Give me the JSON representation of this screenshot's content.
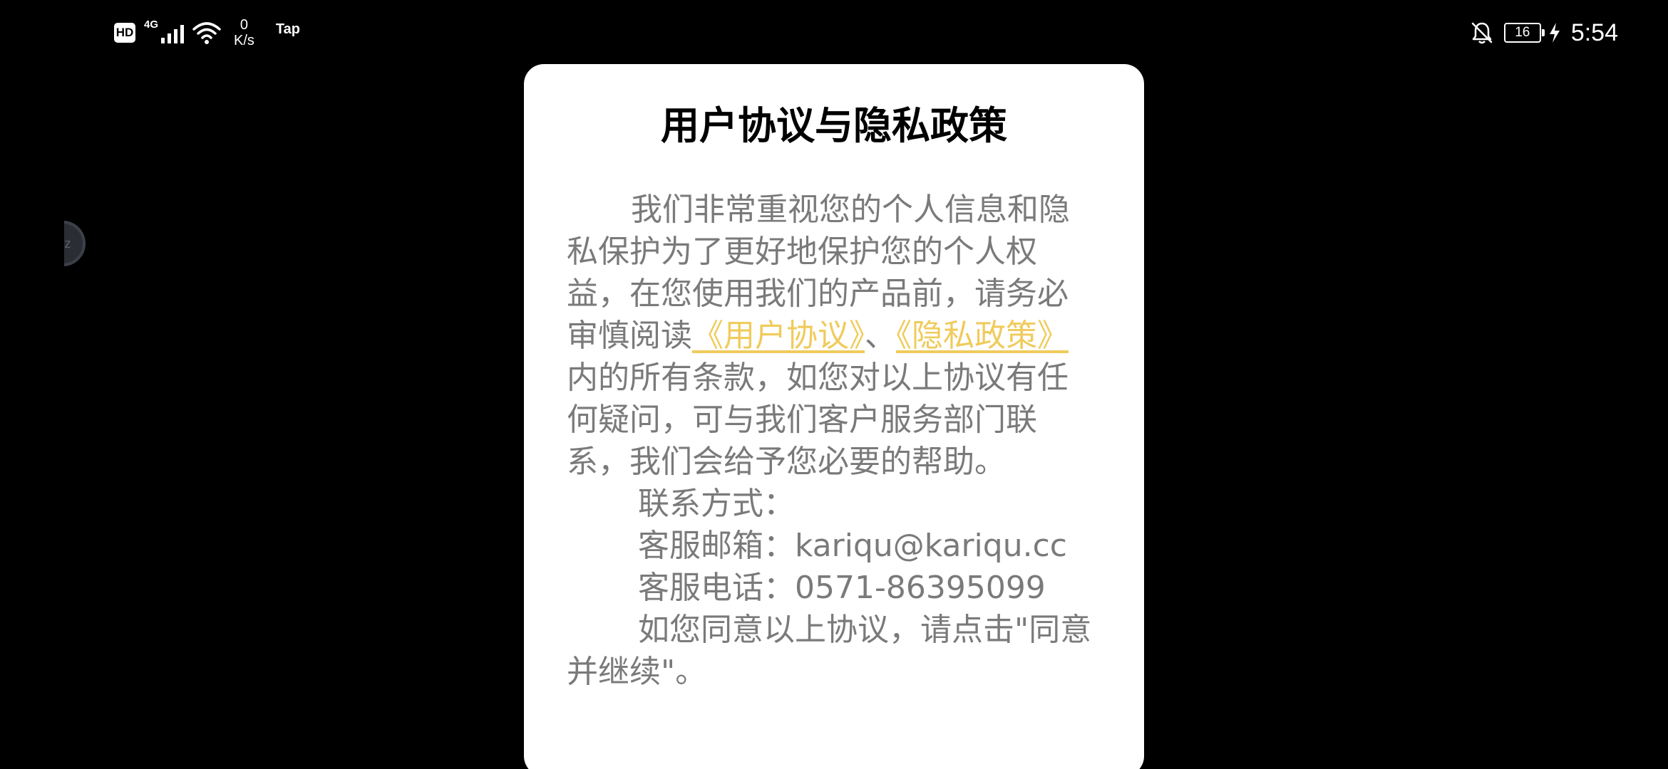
{
  "status_bar": {
    "hd_label": "HD",
    "network_type": "4G",
    "speed_value": "0",
    "speed_unit": "K/s",
    "app_label": "Tap",
    "battery_level": "16",
    "time": "5:54",
    "icons": [
      "signal-icon",
      "wifi-icon",
      "bell-off-icon",
      "battery-icon",
      "charging-icon"
    ],
    "color": "#ffffff"
  },
  "float_ball": {
    "label": "fcz"
  },
  "dialog": {
    "title": "用户协议与隐私政策",
    "intro_text": "我们非常重视您的个人信息和隐私保护为了更好地保护您的个人权益，在您使用我们的产品前，请务必审慎阅读",
    "user_agreement_link": "《用户协议》",
    "separator": "、",
    "privacy_policy_link": "《隐私政策》",
    "after_links_text": "内的所有条款，如您对以上协议有任何疑问，可与我们客户服务部门联系，我们会给予您必要的帮助。",
    "contact_heading": "联系方式：",
    "email_line": "客服邮箱：kariqu@kariqu.cc",
    "phone_line": "客服电话：0571-86395099",
    "consent_text": "如您同意以上协议，请点击\"同意并继续\"。",
    "link_color": "#f0cb5c",
    "text_color": "#7a7a7a"
  }
}
